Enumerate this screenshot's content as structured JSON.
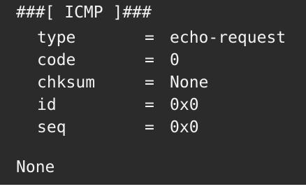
{
  "terminal": {
    "header": "###[ ICMP ]###",
    "fields": [
      {
        "name": "type",
        "eq": "=",
        "value": "echo-request"
      },
      {
        "name": "code",
        "eq": "=",
        "value": "0"
      },
      {
        "name": "chksum",
        "eq": "=",
        "value": "None"
      },
      {
        "name": "id",
        "eq": "=",
        "value": "0x0"
      },
      {
        "name": "seq",
        "eq": "=",
        "value": "0x0"
      }
    ],
    "result": "None"
  },
  "colors": {
    "background": "#2b2b2b",
    "text": "#f2f2f2"
  }
}
